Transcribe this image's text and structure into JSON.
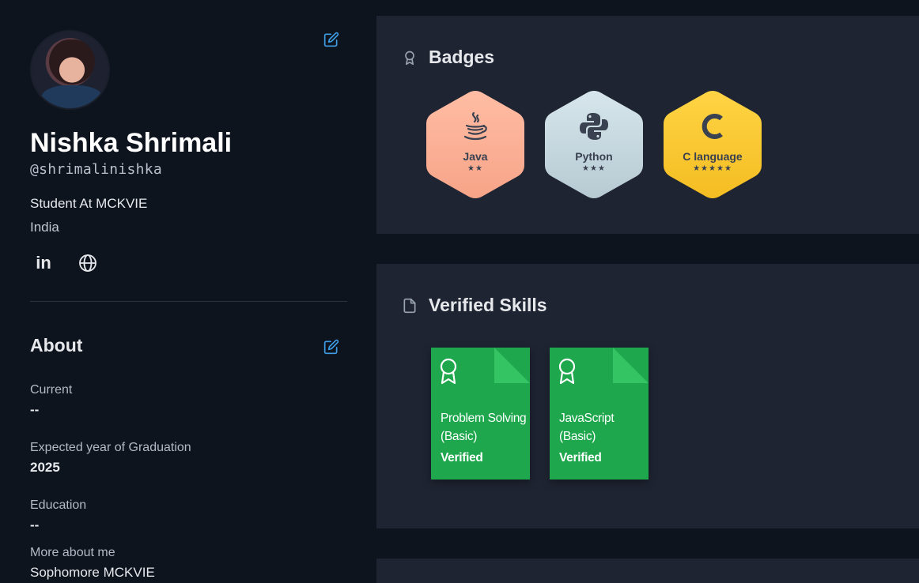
{
  "profile": {
    "name": "Nishka Shrimali",
    "handle": "@shrimalinishka",
    "job": "Student At MCKVIE",
    "country": "India",
    "social": {
      "linkedin_label": "in"
    }
  },
  "about": {
    "title": "About",
    "fields": [
      {
        "label": "Current",
        "value": "--"
      },
      {
        "label": "Expected year of Graduation",
        "value": "2025"
      },
      {
        "label": "Education",
        "value": "--"
      },
      {
        "label": "More about me",
        "value": "Sophomore MCKVIE"
      }
    ]
  },
  "badges": {
    "title": "Badges",
    "items": [
      {
        "label": "Java",
        "stars": "★★",
        "color_top": "#ffb9a0",
        "color_bottom": "#f5a386",
        "icon": "java-cup-icon"
      },
      {
        "label": "Python",
        "stars": "★★★",
        "color_top": "#d4e4ea",
        "color_bottom": "#b9ccd3",
        "icon": "python-logo-icon"
      },
      {
        "label": "C language",
        "stars": "★★★★★",
        "color_top": "#ffd241",
        "color_bottom": "#f5bf24",
        "icon": "c-letter-icon",
        "glyph": "C"
      }
    ]
  },
  "skills": {
    "title": "Verified Skills",
    "items": [
      {
        "name": "Problem Solving (Basic)",
        "status": "Verified"
      },
      {
        "name": "JavaScript (Basic)",
        "status": "Verified"
      }
    ],
    "color": "#1ea74c"
  },
  "colors": {
    "background": "#0e141e",
    "card": "#1f2432",
    "accent": "#3d9ce3"
  }
}
